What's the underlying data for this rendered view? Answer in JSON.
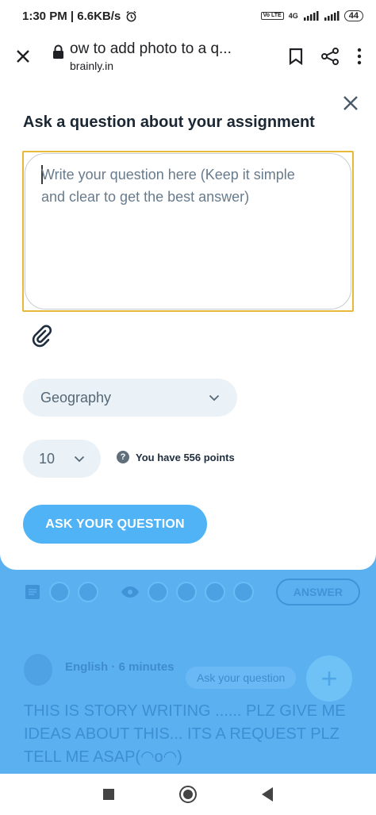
{
  "status_bar": {
    "time_speed": "1:30 PM | 6.6KB/s",
    "network_small": "4G",
    "volte": "Vo LTE",
    "battery": "44"
  },
  "browser": {
    "page_title": "ow to add photo to a q...",
    "domain": "brainly.in"
  },
  "modal": {
    "title": "Ask a question about your assignment",
    "question_placeholder": "Write your question here (Keep it simple and clear to get the best answer)",
    "subject_value": "Geography",
    "points_value": "10",
    "points_info": "You have 556 points",
    "ask_button": "ASK YOUR QUESTION"
  },
  "background_feed": {
    "answer_button": "ANSWER",
    "meta": "English · 6 minutes",
    "ask_pill": "Ask your question",
    "story_text": "THIS IS STORY WRITING ...... PLZ GIVE ME IDEAS ABOUT THIS... ITS A REQUEST PLZ TELL ME ASAP(◠o◠)",
    "fab_symbol": "+"
  },
  "colors": {
    "accent_blue": "#4fb3f6",
    "overlay_blue": "#5bb0f0",
    "focus_border": "#e6b93a"
  }
}
